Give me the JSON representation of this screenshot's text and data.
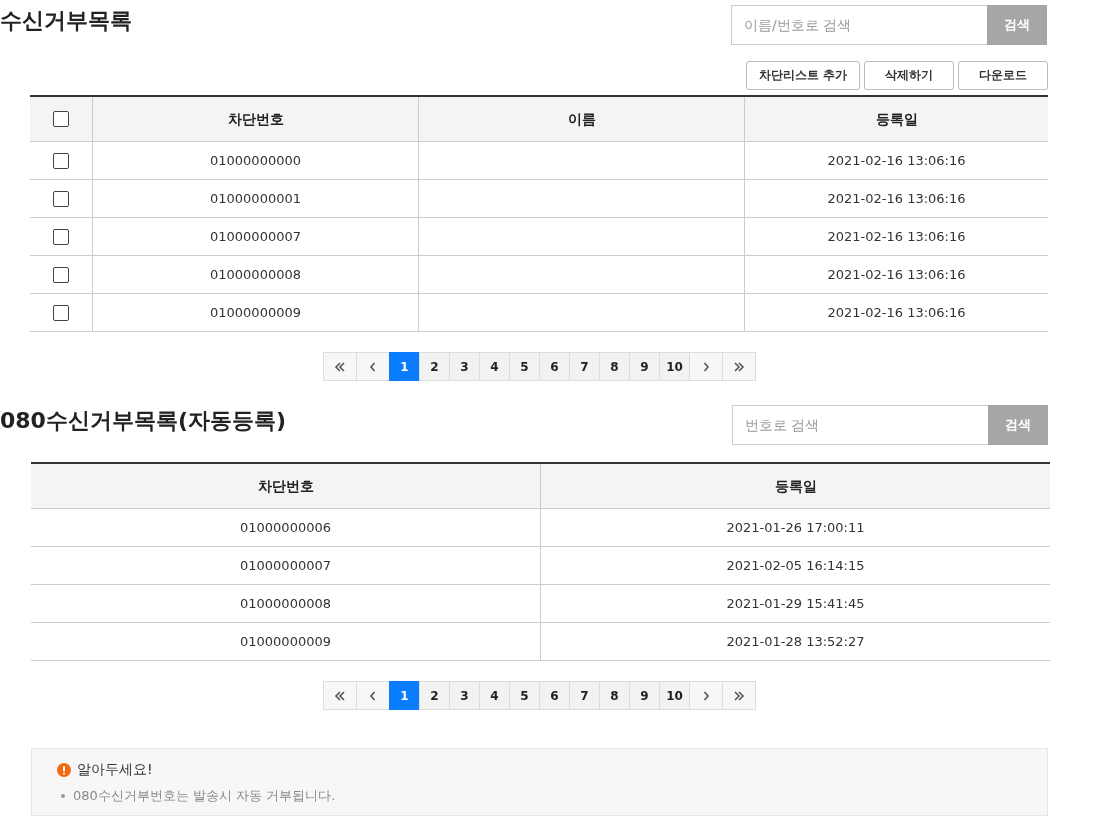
{
  "blocklist": {
    "title": "수신거부목록",
    "search": {
      "placeholder": "이름/번호로 검색",
      "button": "검색"
    },
    "actions": [
      "차단리스트 추가",
      "삭제하기",
      "다운로드"
    ],
    "table": {
      "select_all_checked": false,
      "columns": [
        "차단번호",
        "이름",
        "등록일"
      ],
      "rows": [
        {
          "checked": false,
          "number": "01000000000",
          "name": "",
          "date": "2021-02-16 13:06:16"
        },
        {
          "checked": false,
          "number": "01000000001",
          "name": "",
          "date": "2021-02-16 13:06:16"
        },
        {
          "checked": false,
          "number": "01000000007",
          "name": "",
          "date": "2021-02-16 13:06:16"
        },
        {
          "checked": false,
          "number": "01000000008",
          "name": "",
          "date": "2021-02-16 13:06:16"
        },
        {
          "checked": false,
          "number": "01000000009",
          "name": "",
          "date": "2021-02-16 13:06:16"
        }
      ]
    },
    "pagination": [
      {
        "label": "1",
        "selected": true
      },
      {
        "label": "2",
        "selected": false
      },
      {
        "label": "3",
        "selected": false
      },
      {
        "label": "4",
        "selected": false
      },
      {
        "label": "5",
        "selected": false
      },
      {
        "label": "6",
        "selected": false
      },
      {
        "label": "7",
        "selected": false
      },
      {
        "label": "8",
        "selected": false
      },
      {
        "label": "9",
        "selected": false
      },
      {
        "label": "10",
        "selected": false
      }
    ]
  },
  "auto_blocklist": {
    "title": "080수신거부목록(자동등록)",
    "search": {
      "placeholder": "번호로 검색",
      "button": "검색"
    },
    "table": {
      "columns": [
        "차단번호",
        "등록일"
      ],
      "rows": [
        {
          "number": "01000000006",
          "date": "2021-01-26 17:00:11"
        },
        {
          "number": "01000000007",
          "date": "2021-02-05 16:14:15"
        },
        {
          "number": "01000000008",
          "date": "2021-01-29 15:41:45"
        },
        {
          "number": "01000000009",
          "date": "2021-01-28 13:52:27"
        }
      ]
    },
    "pagination": [
      {
        "label": "1",
        "selected": true
      },
      {
        "label": "2",
        "selected": false
      },
      {
        "label": "3",
        "selected": false
      },
      {
        "label": "4",
        "selected": false
      },
      {
        "label": "5",
        "selected": false
      },
      {
        "label": "6",
        "selected": false
      },
      {
        "label": "7",
        "selected": false
      },
      {
        "label": "8",
        "selected": false
      },
      {
        "label": "9",
        "selected": false
      },
      {
        "label": "10",
        "selected": false
      }
    ]
  },
  "notice": {
    "title": "알아두세요!",
    "items": [
      "080수신거부번호는 발송시 자동 거부됩니다."
    ]
  }
}
